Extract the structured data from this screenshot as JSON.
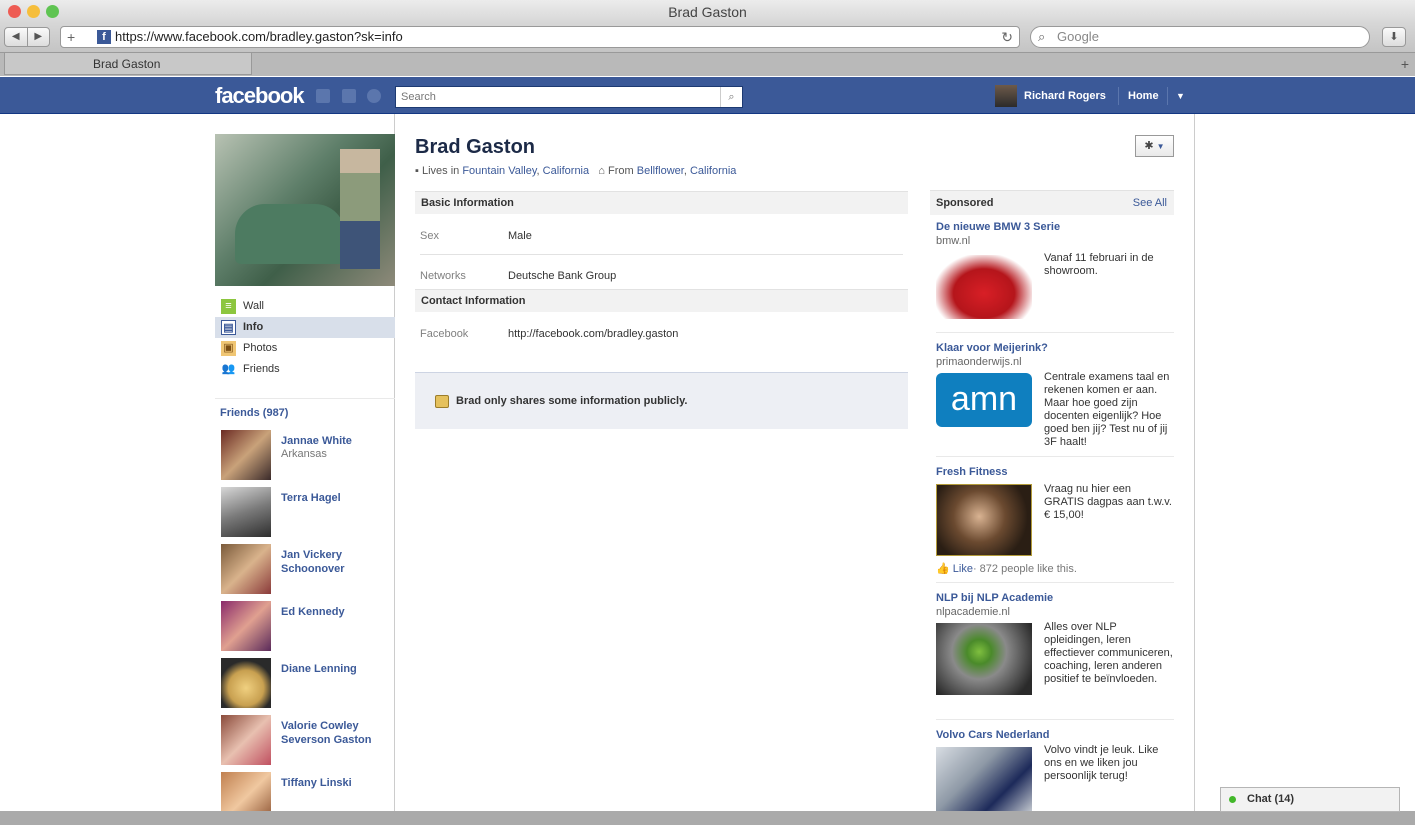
{
  "browser": {
    "window_title": "Brad Gaston",
    "url": "https://www.facebook.com/bradley.gaston?sk=info",
    "search_placeholder": "Google",
    "tab_title": "Brad Gaston"
  },
  "fb_header": {
    "logo": "facebook",
    "search_placeholder": "Search",
    "user_name": "Richard Rogers",
    "home_label": "Home"
  },
  "profile": {
    "name": "Brad Gaston",
    "lives_prefix": "Lives in",
    "lives_city": "Fountain Valley",
    "lives_state": "California",
    "from_prefix": "From",
    "from_city": "Bellflower",
    "from_state": "California"
  },
  "left_nav": [
    {
      "label": "Wall",
      "icon": "wall-icon"
    },
    {
      "label": "Info",
      "icon": "info-icon",
      "selected": true
    },
    {
      "label": "Photos",
      "icon": "photos-icon"
    },
    {
      "label": "Friends",
      "icon": "friends-icon"
    }
  ],
  "friends": {
    "header": "Friends (987)",
    "list": [
      {
        "name": "Jannae White",
        "location": "Arkansas"
      },
      {
        "name": "Terra Hagel",
        "location": ""
      },
      {
        "name": "Jan Vickery Schoonover",
        "location": ""
      },
      {
        "name": "Ed Kennedy",
        "location": ""
      },
      {
        "name": "Diane Lenning",
        "location": ""
      },
      {
        "name": "Valorie Cowley Severson Gaston",
        "location": ""
      },
      {
        "name": "Tiffany Linski",
        "location": ""
      }
    ]
  },
  "info": {
    "basic_header": "Basic Information",
    "sex_label": "Sex",
    "sex_value": "Male",
    "networks_label": "Networks",
    "networks_value": "Deutsche Bank Group",
    "contact_header": "Contact Information",
    "facebook_label": "Facebook",
    "facebook_value": "http://facebook.com/bradley.gaston",
    "public_notice": "Brad only shares some information publicly."
  },
  "sponsored": {
    "header": "Sponsored",
    "see_all": "See All",
    "ads": [
      {
        "title": "De nieuwe BMW 3 Serie",
        "domain": "bmw.nl",
        "body": "Vanaf 11 februari in de showroom."
      },
      {
        "title": "Klaar voor Meijerink?",
        "domain": "primaonderwijs.nl",
        "body": "Centrale examens taal en rekenen komen er aan. Maar hoe goed zijn docenten eigenlijk? Hoe goed ben jij? Test nu of jij 3F haalt!",
        "logo_text": "amn"
      },
      {
        "title": "Fresh Fitness",
        "domain": "",
        "body": "Vraag nu hier een GRATIS dagpas aan t.w.v. € 15,00!",
        "like_label": "Like",
        "like_count": "· 872 people like this."
      },
      {
        "title": "NLP bij NLP Academie",
        "domain": "nlpacademie.nl",
        "body": "Alles over NLP opleidingen, leren effectiever communiceren, coaching, leren anderen positief te beïnvloeden."
      },
      {
        "title": "Volvo Cars Nederland",
        "domain": "",
        "body": "Volvo vindt je leuk. Like ons en we liken jou persoonlijk terug!"
      }
    ]
  },
  "chat": {
    "label": "Chat (14)"
  },
  "colors": {
    "fb_blue": "#3b5998",
    "link": "#3b5998",
    "amn_blue": "#0f7fbf"
  }
}
